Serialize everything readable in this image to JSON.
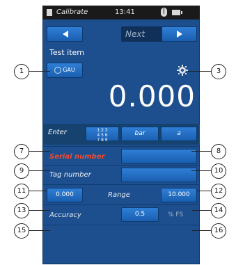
{
  "status_bar": {
    "app_name": "Calibrate",
    "time": "13:41",
    "bluetooth_icon": "bluetooth-icon",
    "battery_icon": "battery-icon"
  },
  "nav": {
    "back_icon": "arrow-left-icon",
    "next_label": "Next",
    "next_icon": "arrow-right-icon"
  },
  "test_item": {
    "label": "Test item",
    "gauge_button_label": "GAU",
    "settings_icon": "gear-icon"
  },
  "reading": {
    "value": "0.000"
  },
  "enter_row": {
    "label": "Enter",
    "keypad_digits": [
      "1 2 3",
      "4 5 6",
      "7 8 9"
    ],
    "unit": "bar",
    "mode": "a"
  },
  "fields": {
    "serial_label": "Serial number",
    "tag_label": "Tag number"
  },
  "range": {
    "min": "0.000",
    "label": "Range",
    "max": "10.000"
  },
  "accuracy": {
    "label": "Accuracy",
    "value": "0.5",
    "unit": "% FS"
  },
  "callouts": [
    "1",
    "3",
    "7",
    "8",
    "9",
    "10",
    "11",
    "12",
    "13",
    "14",
    "15",
    "16"
  ]
}
